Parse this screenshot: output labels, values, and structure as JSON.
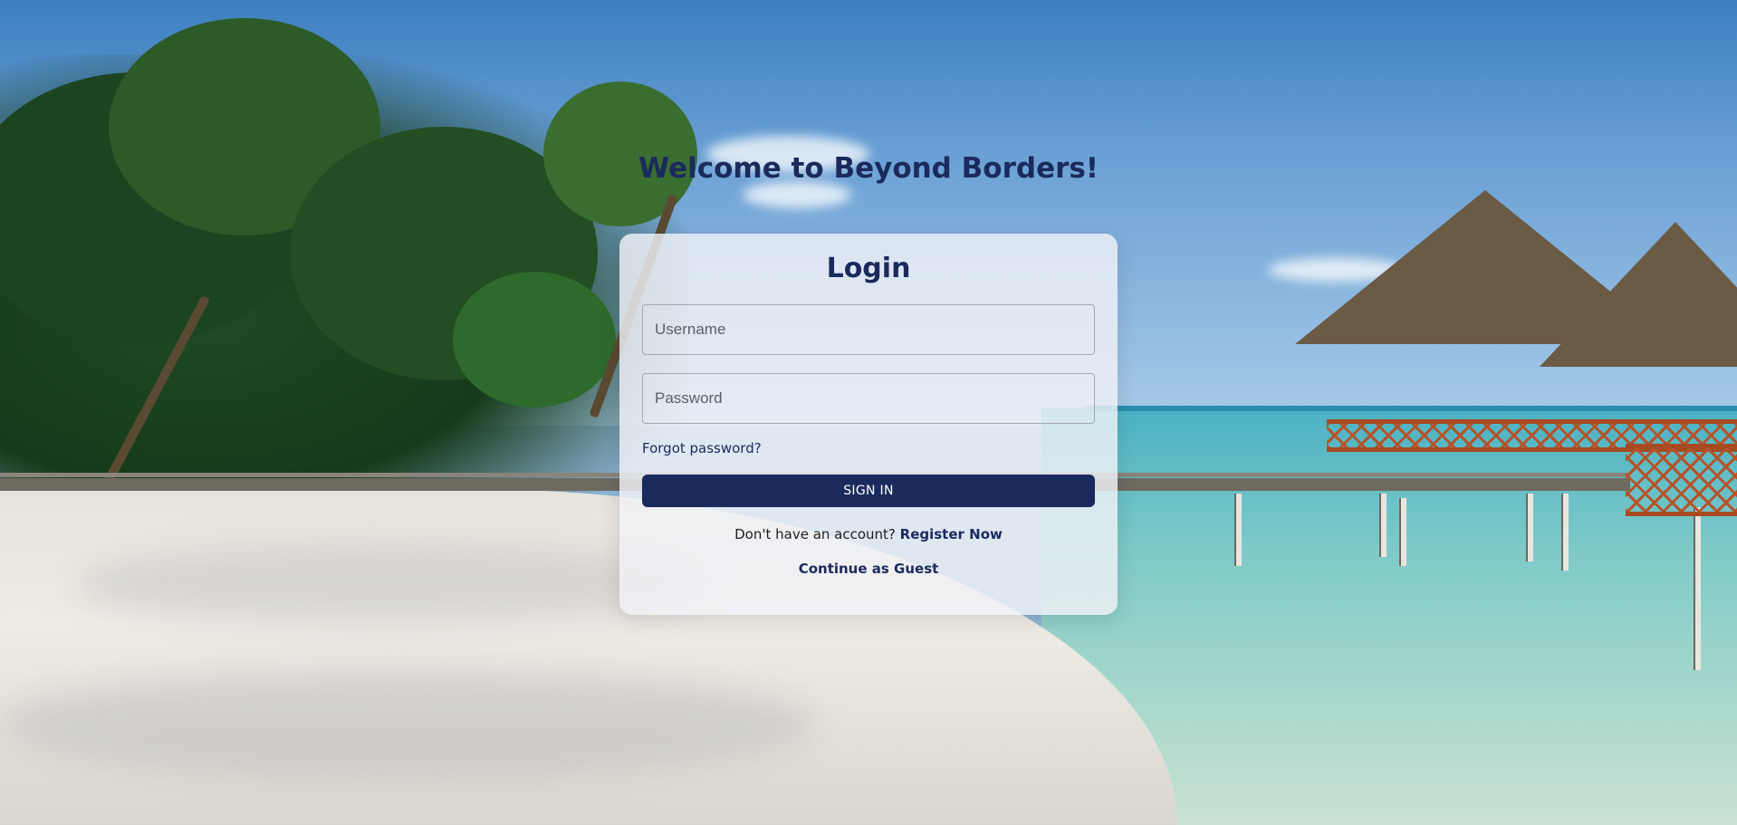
{
  "page": {
    "welcome_heading": "Welcome to Beyond Borders!",
    "background_image": "tropical-beach-overwater-bungalows"
  },
  "login": {
    "title": "Login",
    "username_placeholder": "Username",
    "password_placeholder": "Password",
    "forgot_password": "Forgot password?",
    "sign_in_label": "SIGN IN",
    "register_prompt": "Don't have an account?",
    "register_link": "Register Now",
    "guest_link": "Continue as Guest"
  },
  "colors": {
    "primary": "#1b2a5c",
    "button_text": "#ffffff",
    "card_background": "rgba(240,242,246,0.82)"
  }
}
